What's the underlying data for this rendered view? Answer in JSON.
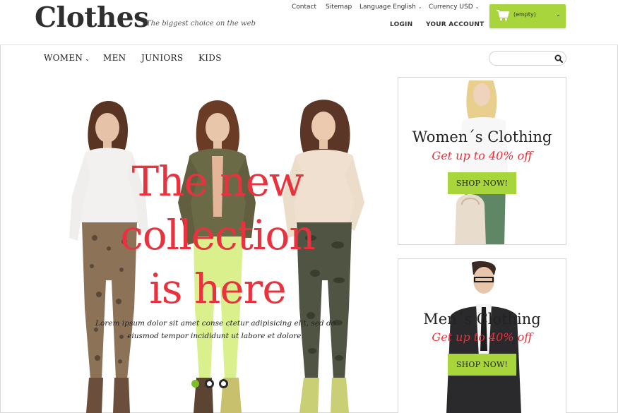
{
  "header": {
    "logo": "Clothes",
    "tagline": "The biggest choice on the web",
    "links": {
      "contact": "Contact",
      "sitemap": "Sitemap",
      "language": "Language English",
      "currency": "Currency USD"
    },
    "account": {
      "login": "LOGIN",
      "your_account": "YOUR ACCOUNT"
    },
    "cart": {
      "label": "(empty)",
      "icon": "shopping-cart-icon"
    }
  },
  "nav": {
    "items": [
      {
        "label": "WOMEN"
      },
      {
        "label": "MEN"
      },
      {
        "label": "JUNIORS"
      },
      {
        "label": "KIDS"
      }
    ],
    "search": {
      "placeholder": "",
      "icon": "search-icon"
    }
  },
  "hero": {
    "title_line1": "The new",
    "title_line2": "collection",
    "title_line3": "is here",
    "subtitle_line1": "Lorem ipsum dolor sit amet conse ctetur adipisicing elit, sed do",
    "subtitle_line2": "eiusmod tempor incididunt ut labore et dolore.",
    "slider_dots": 3,
    "active_dot": 1
  },
  "promos": {
    "women": {
      "title": "Women´s Clothing",
      "offer": "Get up to 40% off",
      "button": "SHOP NOW!"
    },
    "men": {
      "title": "Men´s Clothing",
      "offer": "Get up to 40% off",
      "button": "SHOP NOW!"
    }
  },
  "colors": {
    "accent_green": "#a8d43c",
    "accent_red": "#e8323e",
    "text_dark": "#2f2f2f"
  }
}
